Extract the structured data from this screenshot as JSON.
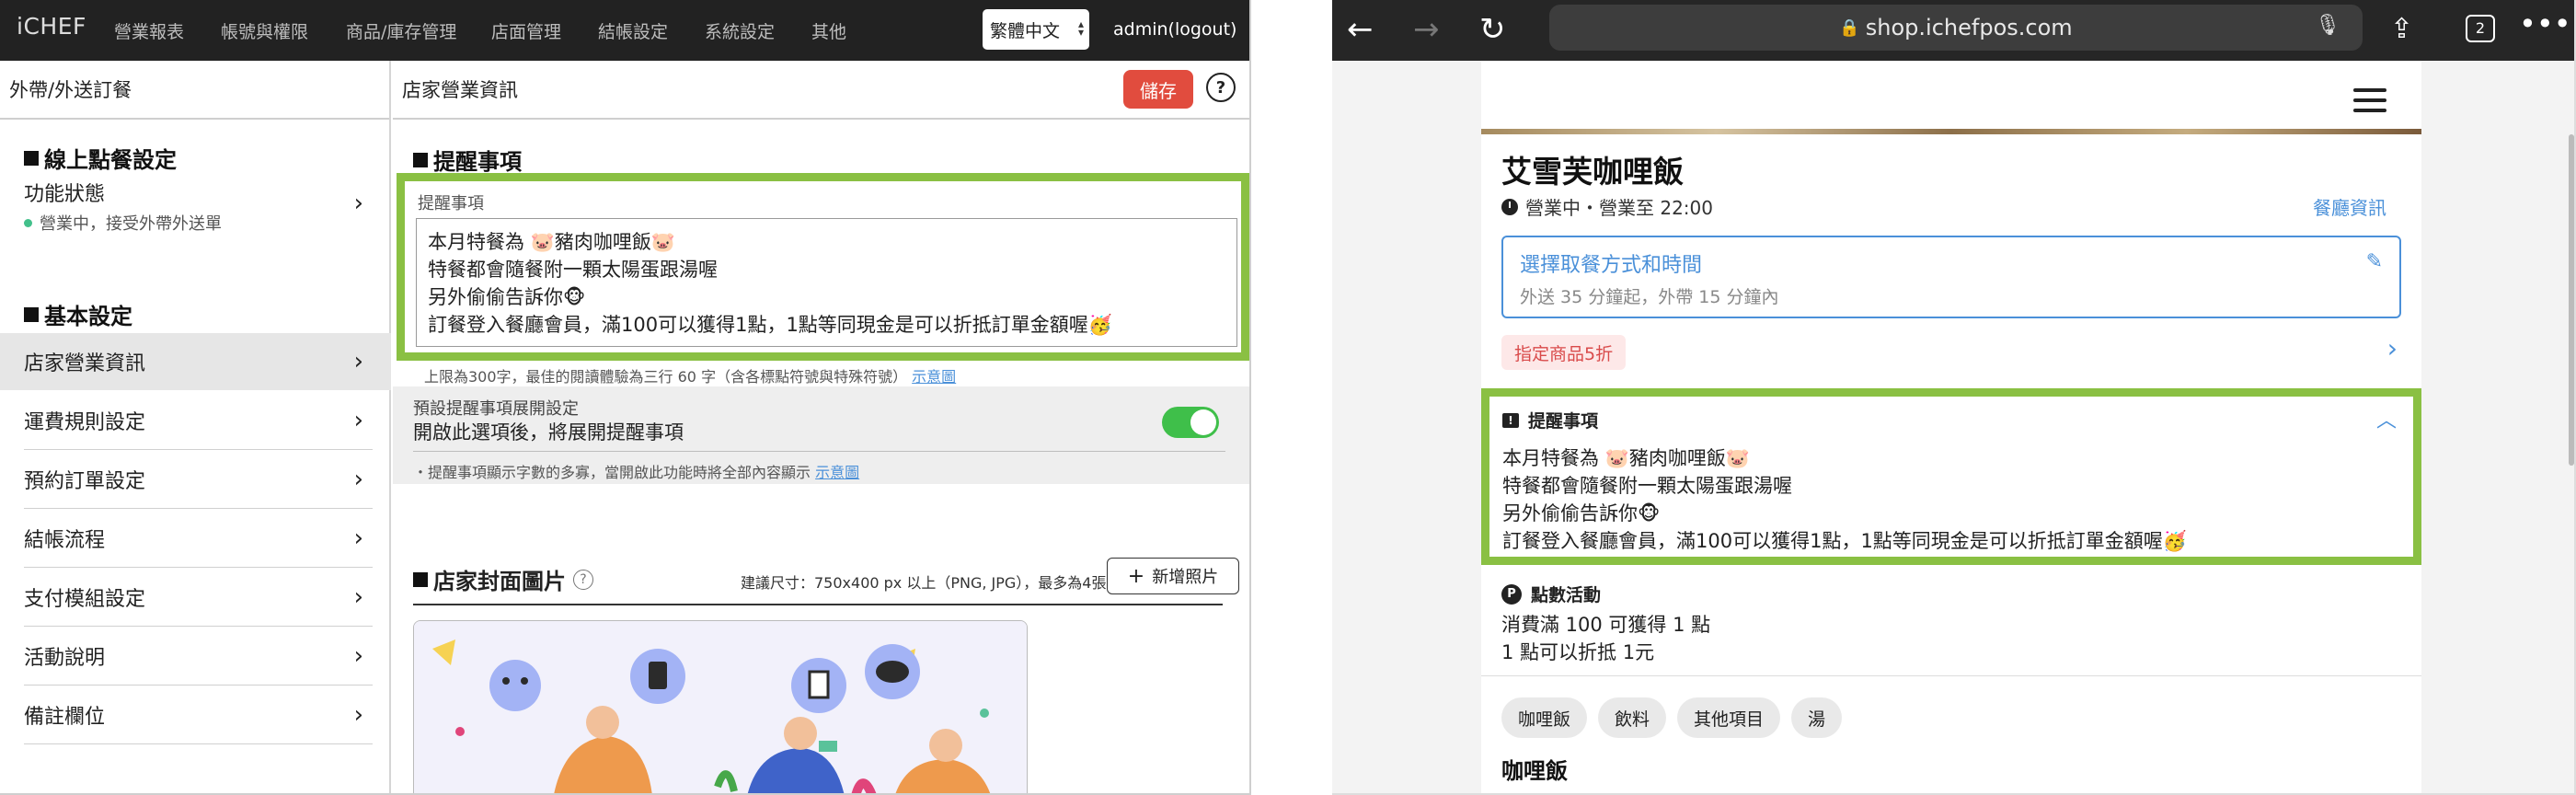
{
  "admin": {
    "brand": "iCHEF",
    "nav": [
      "營業報表",
      "帳號與權限",
      "商品/庫存管理",
      "店面管理",
      "結帳設定",
      "系統設定",
      "其他"
    ],
    "language": "繁體中文",
    "user": "admin(logout)",
    "left_header": "外帶/外送訂餐",
    "online_section": "線上點餐設定",
    "function_status": {
      "label": "功能狀態",
      "status": "營業中，接受外帶外送單"
    },
    "basic_section": "基本設定",
    "menu": [
      "店家營業資訊",
      "運費規則設定",
      "預約訂單設定",
      "結帳流程",
      "支付模組設定",
      "活動說明",
      "備註欄位"
    ],
    "right_header": "店家營業資訊",
    "save_label": "儲存",
    "help_glyph": "?",
    "reminder_section": "提醒事項",
    "reminder_label": "提醒事項",
    "reminder_lines": [
      "本月特餐為 🐷豬肉咖哩飯🐷",
      "特餐都會隨餐附一顆太陽蛋跟湯喔",
      "另外偷偷告訴你🐵",
      "訂餐登入餐廳會員，滿100可以獲得1點，1點等同現金是可以折抵訂單金額喔🥳"
    ],
    "reminder_hint": "上限為300字，最佳的閱讀體驗為三行 60 字（含各標點符號與特殊符號）",
    "reminder_hint_link": "示意圖",
    "expand_title": "預設提醒事項展開設定",
    "expand_text": "開啟此選項後，將展開提醒事項",
    "expand_hint": "・提醒事項顯示字數的多寡，當開啟此功能時將全部內容顯示",
    "expand_hint_link": "示意圖",
    "toggle_on": true,
    "cover_section": "店家封面圖片",
    "cover_size": "建議尺寸：750x400 px 以上（PNG, JPG），最多為4張",
    "add_photo": "新增照片"
  },
  "browser": {
    "url": "shop.ichefpos.com",
    "tab_count": "2",
    "restaurant_name": "艾雪芙咖哩飯",
    "opening": "營業中・營業至  22:00",
    "restaurant_info_link": "餐廳資訊",
    "pickup_title": "選擇取餐方式和時間",
    "pickup_sub": "外送 35 分鐘起，外帶 15 分鐘內",
    "promo": "指定商品5折",
    "note_title": "提醒事項",
    "note_lines": [
      "本月特餐為 🐷豬肉咖哩飯🐷",
      "特餐都會隨餐附一顆太陽蛋跟湯喔",
      "另外偷偷告訴你🐵",
      "訂餐登入餐廳會員，滿100可以獲得1點，1點等同現金是可以折抵訂單金額喔🥳"
    ],
    "points_title": "點數活動",
    "points_glyph": "P",
    "points_lines": [
      "消費滿 100 可獲得 1 點",
      "1 點可以折抵 1元"
    ],
    "categories": [
      "咖哩飯",
      "飲料",
      "其他項目",
      "湯"
    ],
    "category_title": "咖哩飯"
  },
  "colors": {
    "highlight": "#8ac043",
    "save": "#e14c3e",
    "link": "#4a90d9",
    "toggle": "#3fbf4a"
  }
}
